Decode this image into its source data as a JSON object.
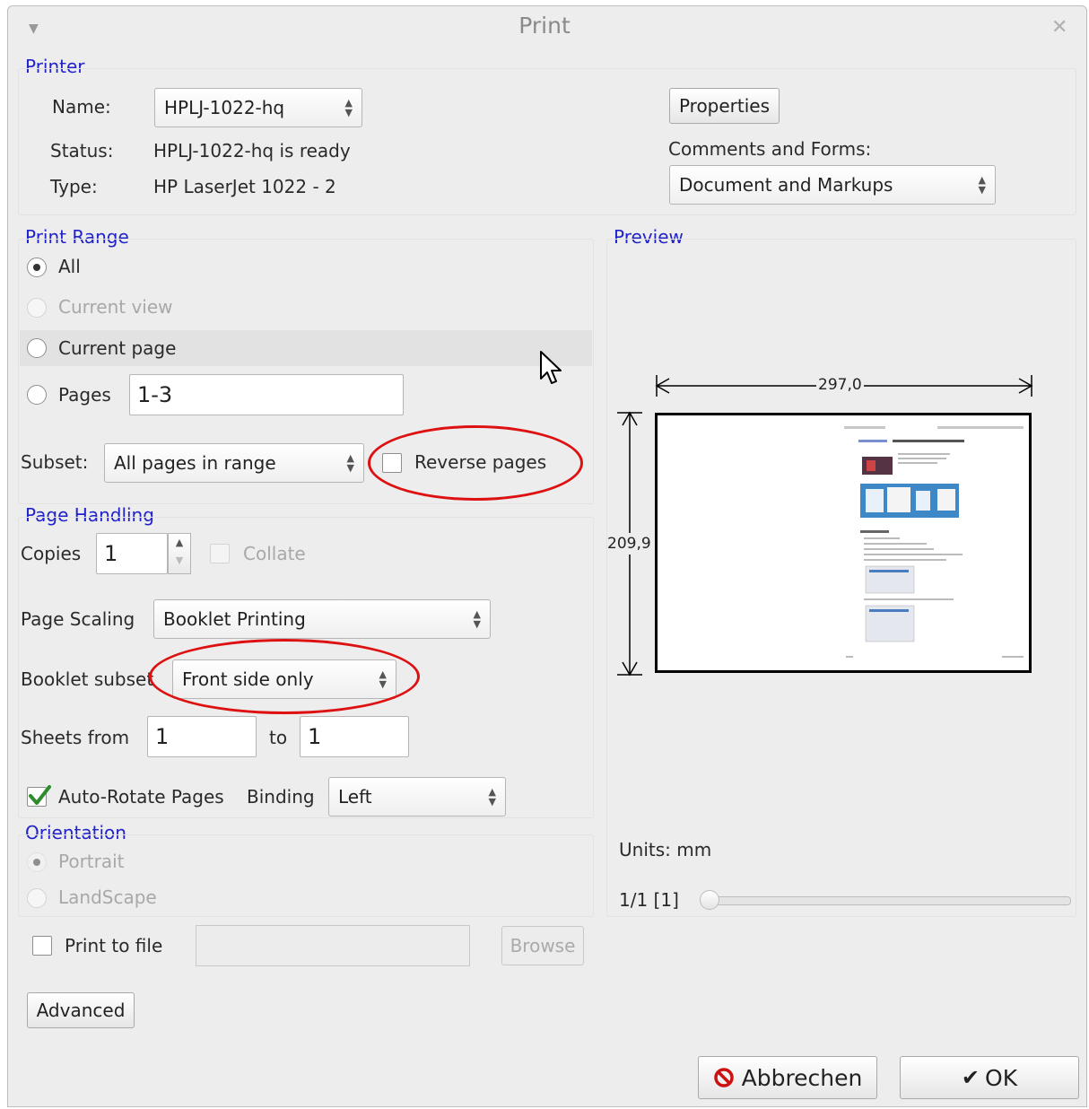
{
  "window": {
    "title": "Print"
  },
  "printer": {
    "section": "Printer",
    "name_label": "Name:",
    "name_value": "HPLJ-1022-hq",
    "status_label": "Status:",
    "status_value": "HPLJ-1022-hq is ready",
    "type_label": "Type:",
    "type_value": "HP LaserJet 1022 -  2",
    "properties_label": "Properties",
    "comments_label": "Comments and Forms:",
    "comments_value": "Document and Markups"
  },
  "print_range": {
    "section": "Print Range",
    "all": "All",
    "current_view": "Current view",
    "current_page": "Current page",
    "pages": "Pages",
    "pages_value": "1-3",
    "subset_label": "Subset:",
    "subset_value": "All pages in range",
    "reverse_label": "Reverse pages"
  },
  "page_handling": {
    "section": "Page Handling",
    "copies_label": "Copies",
    "copies_value": "1",
    "collate_label": "Collate",
    "scaling_label": "Page Scaling",
    "scaling_value": "Booklet Printing",
    "booklet_label": "Booklet subset",
    "booklet_value": "Front side only",
    "sheets_label": "Sheets from",
    "sheets_from": "1",
    "to_label": "to",
    "sheets_to": "1",
    "autorotate_label": "Auto-Rotate Pages",
    "binding_label": "Binding",
    "binding_value": "Left"
  },
  "orientation": {
    "section": "Orientation",
    "portrait": "Portrait",
    "landscape": "LandScape"
  },
  "preview": {
    "section": "Preview",
    "width": "297,0",
    "height": "209,9",
    "units": "Units: mm",
    "page": "1/1  [1]"
  },
  "file": {
    "print_to_file": "Print to file",
    "browse": "Browse",
    "advanced": "Advanced"
  },
  "actions": {
    "cancel": "Abbrechen",
    "ok": "OK"
  }
}
